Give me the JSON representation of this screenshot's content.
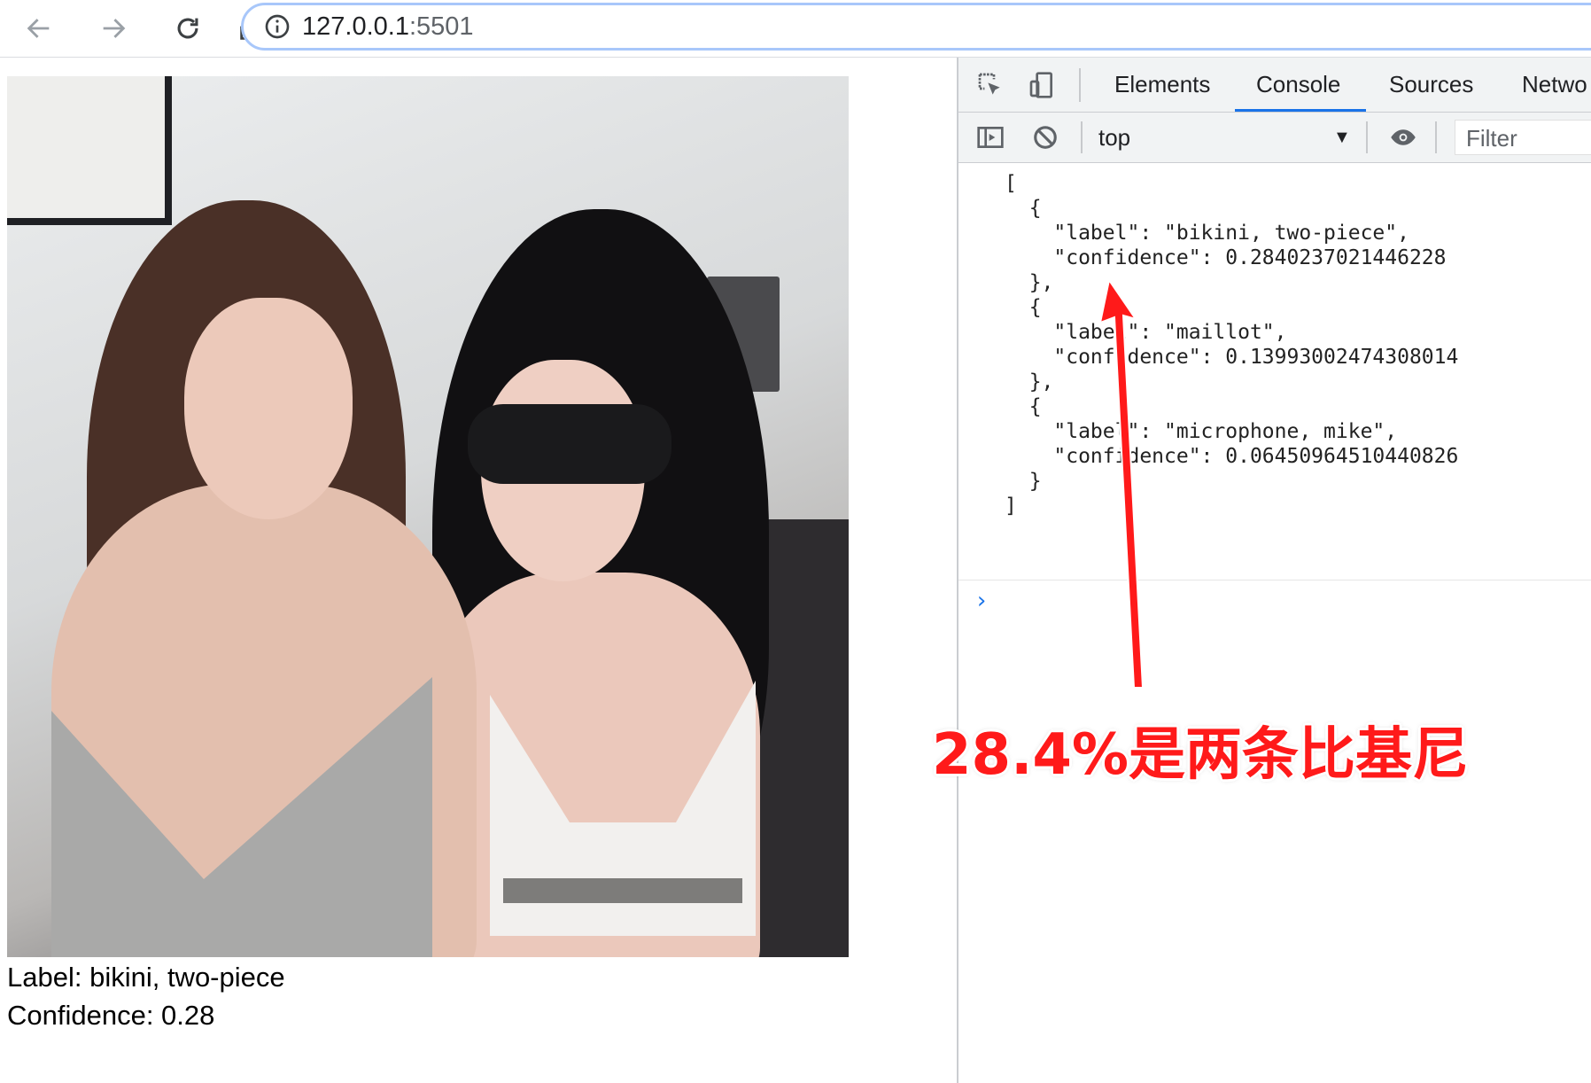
{
  "browser": {
    "url_host": "127.0.0.1",
    "url_port": ":5501"
  },
  "page": {
    "label_text": "Label: bikini, two-piece",
    "confidence_text": "Confidence: 0.28"
  },
  "devtools": {
    "tabs": [
      "Elements",
      "Console",
      "Sources",
      "Netwo"
    ],
    "active_tab": "Console",
    "context": "top",
    "filter_placeholder": "Filter",
    "console_output": "[\n  {\n    \"label\": \"bikini, two-piece\",\n    \"confidence\": 0.2840237021446228\n  },\n  {\n    \"label\": \"maillot\",\n    \"confidence\": 0.13993002474308014\n  },\n  {\n    \"label\": \"microphone, mike\",\n    \"confidence\": 0.06450964510440826\n  }\n]"
  },
  "annotation": {
    "text": "28.4%是两条比基尼",
    "color": "#ff1a1a"
  },
  "colors": {
    "accent": "#1a73e8",
    "omnibox_border": "#a8c7fa"
  }
}
